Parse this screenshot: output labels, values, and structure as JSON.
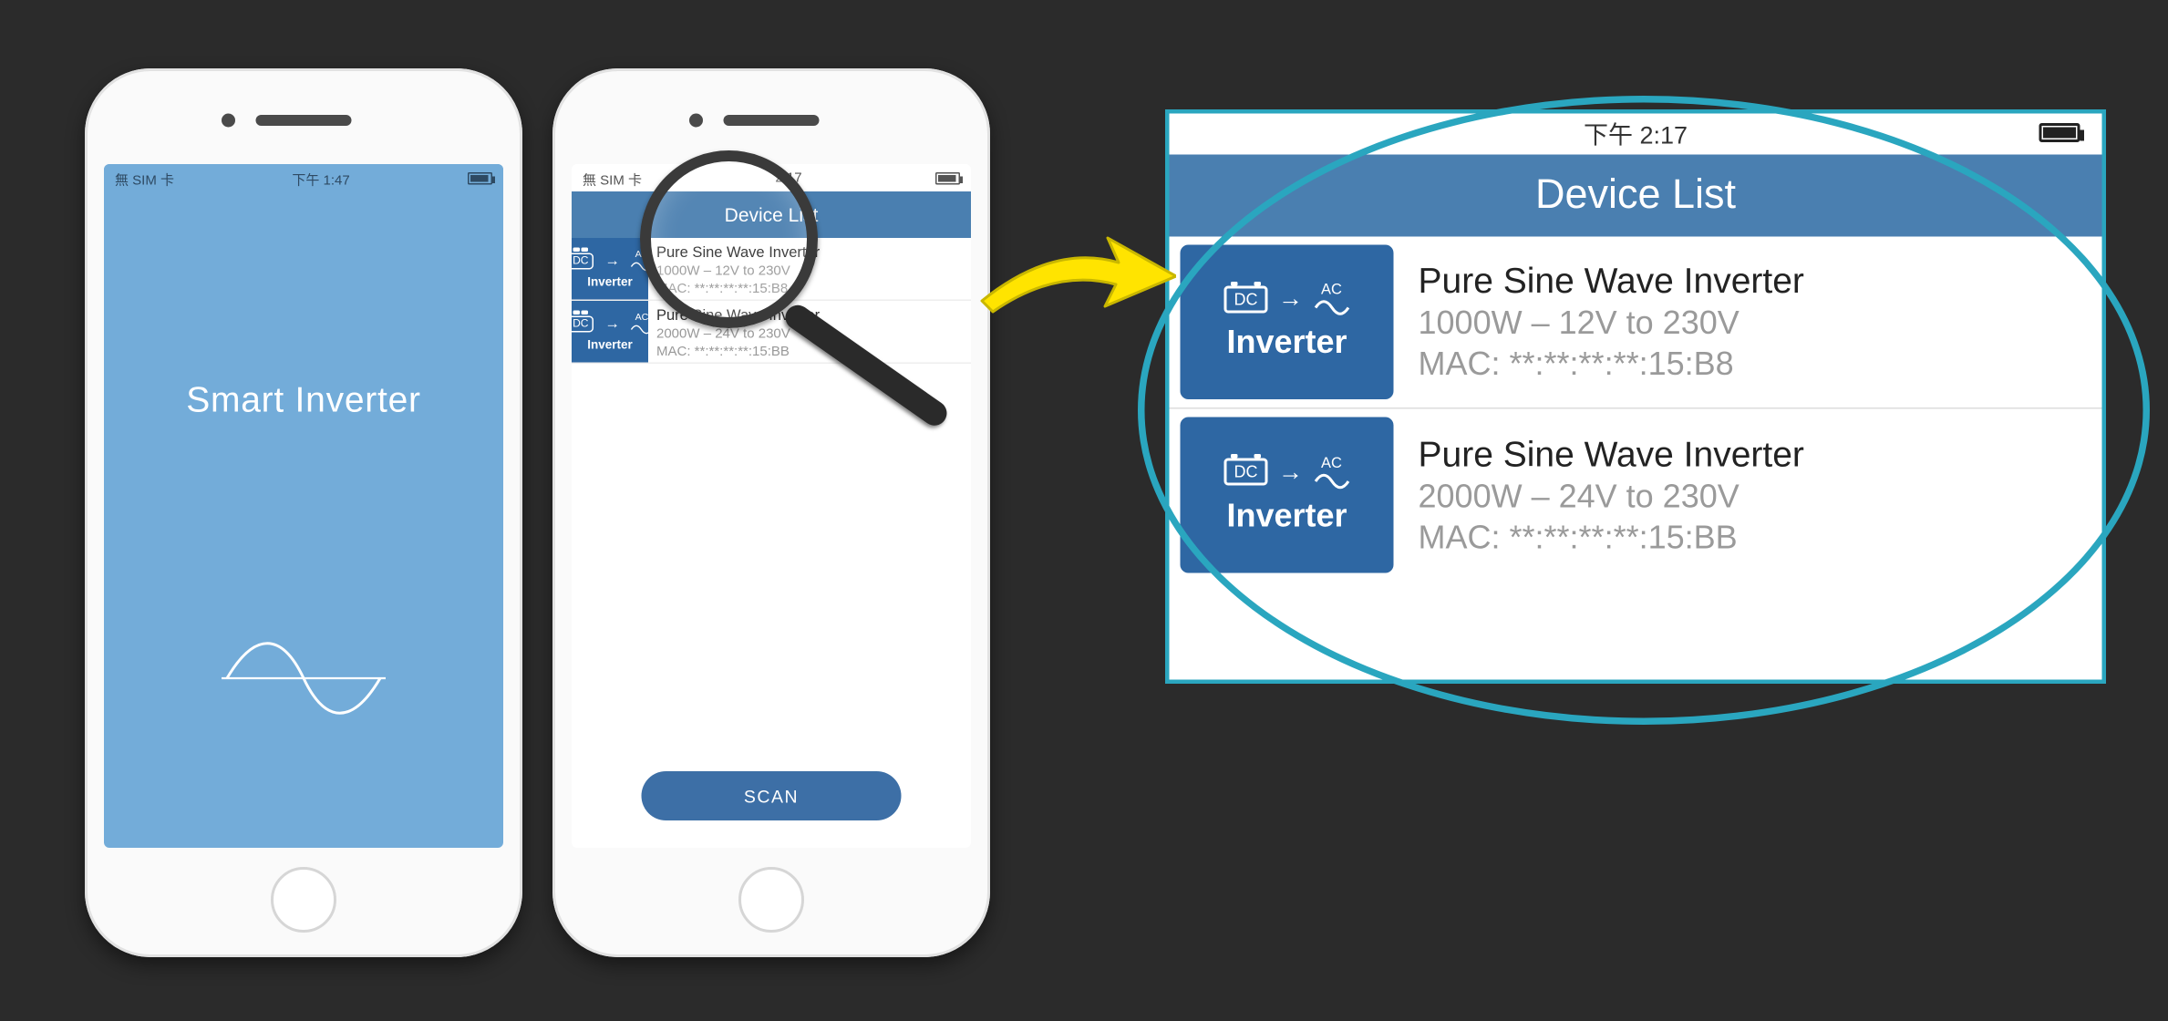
{
  "splash": {
    "carrier": "無 SIM 卡",
    "time": "下午 1:47",
    "title": "Smart Inverter"
  },
  "listScreen": {
    "carrier": "無 SIM 卡",
    "time": "2:17",
    "navTitle": "Device List",
    "scanLabel": "SCAN",
    "iconLabel": "Inverter",
    "devices": [
      {
        "name": "Pure Sine Wave Inverter",
        "spec": "1000W – 12V to 230V",
        "mac": "MAC: **:**:**:**:15:B8"
      },
      {
        "name": "Pure Sine Wave Inverter",
        "spec": "2000W – 24V to 230V",
        "mac": "MAC: **:**:**:**:15:BB"
      }
    ]
  },
  "callout": {
    "statusTime": "下午 2:17",
    "navTitle": "Device List",
    "iconLabel": "Inverter",
    "dcLabel": "DC",
    "acLabel": "AC",
    "devices": [
      {
        "name": "Pure Sine Wave Inverter",
        "spec": "1000W – 12V to 230V",
        "mac": "MAC: **:**:**:**:15:B8"
      },
      {
        "name": "Pure Sine Wave Inverter",
        "spec": "2000W – 24V to 230V",
        "mac": "MAC: **:**:**:**:15:BB"
      }
    ]
  }
}
